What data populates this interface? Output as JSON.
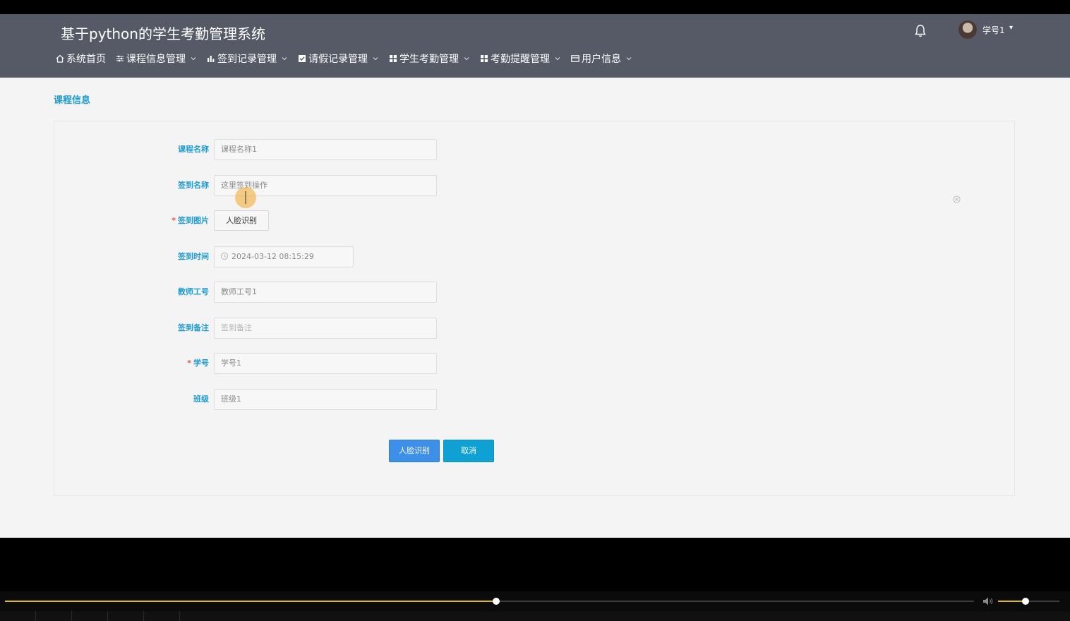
{
  "app": {
    "title": "基于python的学生考勤管理系统",
    "user_name": "学号1",
    "user_caret": "▾"
  },
  "nav": [
    {
      "label": "系统首页",
      "icon": "home-icon",
      "has_dropdown": false
    },
    {
      "label": "课程信息管理",
      "icon": "sliders-icon",
      "has_dropdown": true
    },
    {
      "label": "签到记录管理",
      "icon": "bar-chart-icon",
      "has_dropdown": true
    },
    {
      "label": "请假记录管理",
      "icon": "check-square-icon",
      "has_dropdown": true
    },
    {
      "label": "学生考勤管理",
      "icon": "grid-icon",
      "has_dropdown": true
    },
    {
      "label": "考勤提醒管理",
      "icon": "grid-icon",
      "has_dropdown": true
    },
    {
      "label": "用户信息",
      "icon": "card-icon",
      "has_dropdown": true
    }
  ],
  "page": {
    "heading": "课程信息"
  },
  "form": {
    "course_name": {
      "label": "课程名称",
      "value": "课程名称1",
      "required": false
    },
    "signin_name": {
      "label": "签到名称",
      "value": "这里签到操作",
      "required": false
    },
    "signin_image": {
      "label": "签到图片",
      "button": "人脸识别",
      "required": true,
      "required_mark": "*"
    },
    "signin_time": {
      "label": "签到时间",
      "value": "2024-03-12 08:15:29",
      "required": false
    },
    "teacher_id": {
      "label": "教师工号",
      "value": "教师工号1",
      "required": false
    },
    "signin_note": {
      "label": "签到备注",
      "placeholder": "签到备注",
      "required": false
    },
    "student_id": {
      "label": "学号",
      "value": "学号1",
      "required": true,
      "required_mark": "*"
    },
    "class_name": {
      "label": "班级",
      "value": "班级1",
      "required": false
    }
  },
  "actions": {
    "submit_label": "人脸识别",
    "cancel_label": "取消"
  },
  "player": {
    "progress": 0.507,
    "volume": 0.45
  },
  "colors": {
    "header_bg": "#555a66",
    "accent_label": "#1e9bd0",
    "primary_button": "#3d8fe8",
    "cancel_button": "#0fa1d4",
    "required_star": "#e2563a",
    "progress": "#e0b80e"
  }
}
